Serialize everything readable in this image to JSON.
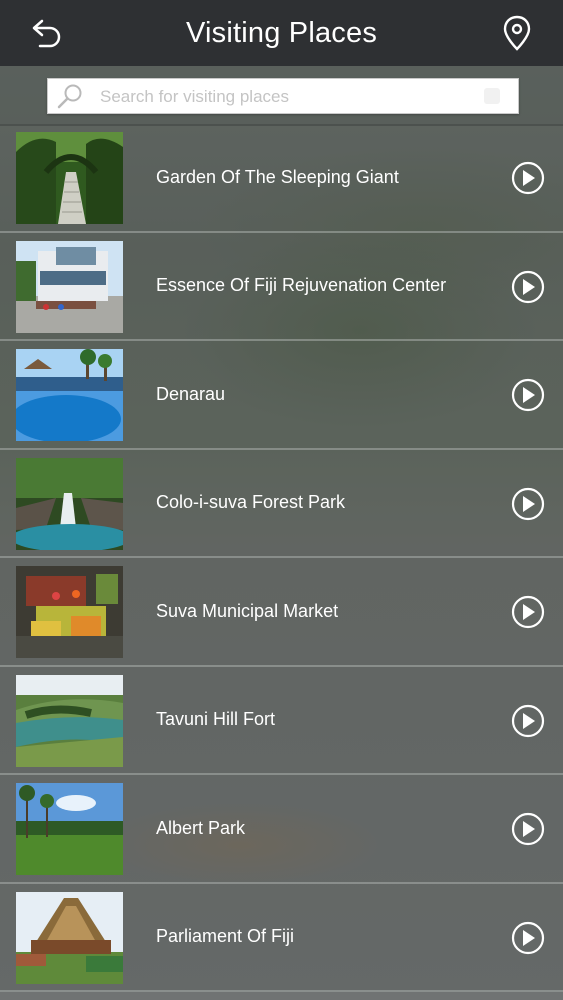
{
  "header": {
    "title": "Visiting Places",
    "back_icon": "back-arrow-icon",
    "location_icon": "location-pin-icon"
  },
  "search": {
    "placeholder": "Search for visiting places",
    "value": "",
    "icon": "search-icon"
  },
  "places": [
    {
      "name": "Garden Of The Sleeping Giant",
      "thumb": "garden-path-photo"
    },
    {
      "name": "Essence Of Fiji Rejuvenation Center",
      "thumb": "spa-building-photo"
    },
    {
      "name": "Denarau",
      "thumb": "resort-pool-photo"
    },
    {
      "name": "Colo-i-suva Forest Park",
      "thumb": "waterfall-pool-photo"
    },
    {
      "name": "Suva Municipal Market",
      "thumb": "fruit-market-photo"
    },
    {
      "name": "Tavuni Hill Fort",
      "thumb": "river-valley-photo"
    },
    {
      "name": "Albert Park",
      "thumb": "park-palms-photo"
    },
    {
      "name": "Parliament Of Fiji",
      "thumb": "parliament-building-photo"
    }
  ],
  "colors": {
    "header_bg": "#2e3033",
    "text": "#ffffff"
  }
}
